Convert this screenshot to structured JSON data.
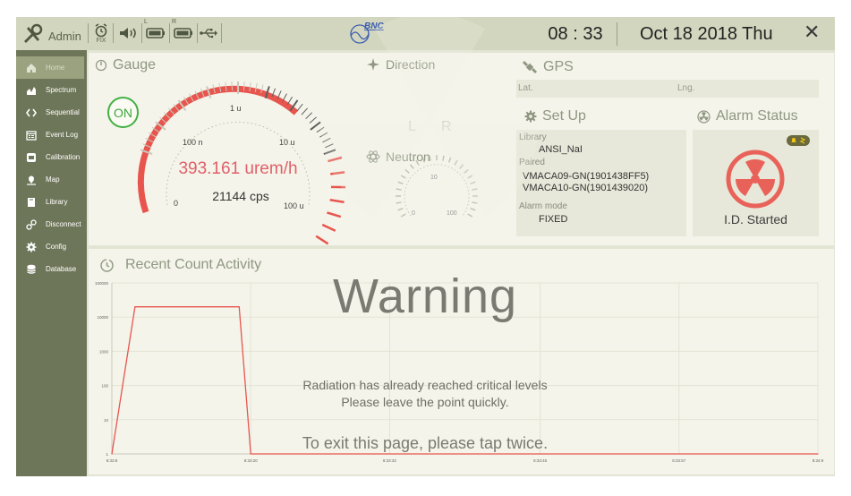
{
  "header": {
    "user_label": "Admin",
    "alarm_mode_indicator": "FIX",
    "battery_left_label": "L",
    "battery_right_label": "R",
    "logo_text": "BNC",
    "time": "08 : 33",
    "date": "Oct 18 2018 Thu",
    "close_symbol": "✕",
    "icons": [
      "admin-tools-icon",
      "alarm-clock-icon",
      "speaker-icon",
      "battery-left-icon",
      "battery-right-icon",
      "usb-icon"
    ]
  },
  "sidebar": {
    "items": [
      {
        "label": "Home",
        "icon": "home-icon",
        "active": true
      },
      {
        "label": "Spectrum",
        "icon": "spectrum-icon"
      },
      {
        "label": "Sequential",
        "icon": "sequential-icon"
      },
      {
        "label": "Event Log",
        "icon": "calendar-icon"
      },
      {
        "label": "Calibration",
        "icon": "calibration-icon"
      },
      {
        "label": "Map",
        "icon": "map-pin-icon"
      },
      {
        "label": "Library",
        "icon": "book-icon"
      },
      {
        "label": "Disconnect",
        "icon": "disconnect-icon"
      },
      {
        "label": "Config",
        "icon": "gear-icon"
      },
      {
        "label": "Database",
        "icon": "database-icon"
      }
    ]
  },
  "gauge": {
    "title": "Gauge",
    "on_label": "ON",
    "dose_rate": "393.161 urem/h",
    "cps": "21144 cps",
    "scale_labels": [
      "0",
      "100 n",
      "1 u",
      "10 u",
      "100 u"
    ]
  },
  "direction": {
    "title": "Direction",
    "left_label": "L",
    "right_label": "R"
  },
  "neutron": {
    "title": "Neutron",
    "scale_labels": [
      "0",
      "10",
      "100"
    ]
  },
  "gps": {
    "title": "GPS",
    "lat_label": "Lat.",
    "lng_label": "Lng."
  },
  "setup": {
    "title": "Set Up",
    "library_label": "Library",
    "library_value": "ANSI_NaI",
    "paired_label": "Paired",
    "paired_values": [
      "VMACA09-GN(1901438FF5)",
      "VMACA10-GN(1901439020)"
    ],
    "alarm_mode_label": "Alarm mode",
    "alarm_mode_value": "FIXED"
  },
  "alarm": {
    "title": "Alarm Status",
    "status_text": "I.D. Started",
    "colors": {
      "ring": "#e9625a",
      "badge": "#6a6a3e"
    }
  },
  "recent_activity": {
    "title": "Recent Count Activity"
  },
  "warning": {
    "title": "Warning",
    "message_line1": "Radiation has  already reached critical levels",
    "message_line2": "Please leave the point quickly.",
    "exit_hint": "To exit this page, please tap twice."
  },
  "colors": {
    "sidebar_bg": "#6e7659",
    "header_bg": "#d2d6be",
    "panel_bg": "#f4f4ea",
    "accent_red": "#e0606a",
    "on_green": "#43b043"
  },
  "chart_data": {
    "type": "line",
    "title": "",
    "xlabel": "",
    "ylabel": "",
    "y_scale": "log",
    "yticks": [
      "1",
      "10",
      "100",
      "1000",
      "10000",
      "100000"
    ],
    "x_tick_labels": [
      "8:33:8",
      "8:33:20",
      "8:33:32",
      "8:33:45",
      "8:33:57",
      "8:34:9"
    ],
    "x": [
      "8:33:8",
      "8:33:10",
      "8:33:15",
      "8:33:19",
      "8:33:20",
      "8:34:9"
    ],
    "series": [
      {
        "color": "#e8554e",
        "values": [
          1,
          20000,
          20000,
          20000,
          1,
          1
        ]
      }
    ],
    "grid": true
  }
}
